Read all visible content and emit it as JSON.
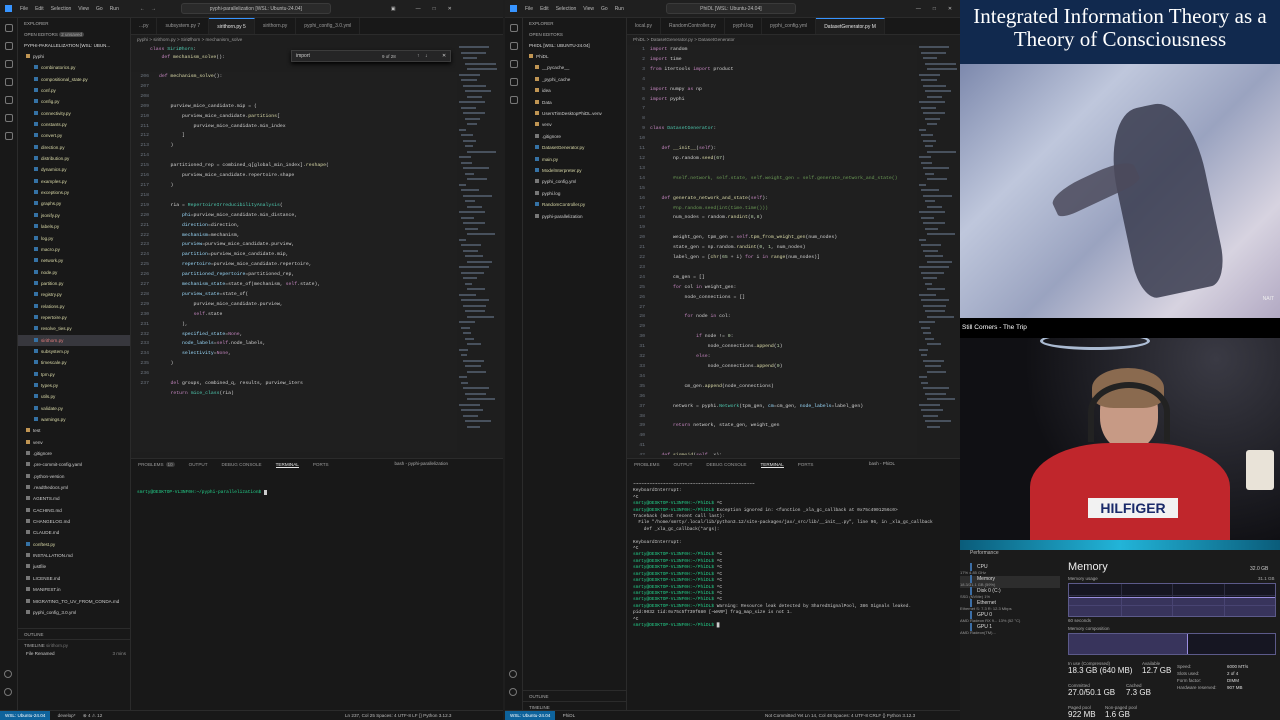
{
  "left_window": {
    "title": "pyphi-parallelization [WSL: Ubuntu-24.04]",
    "menu": [
      "File",
      "Edit",
      "Selection",
      "View",
      "Go",
      "Run"
    ],
    "explorer_label": "EXPLORER",
    "open_editors_label": "OPEN EDITORS",
    "open_editors_badge": "2 unsaved",
    "workspace_label": "PYPHI-PARALLELIZATION [WSL: UBUN...",
    "tree": [
      "pyphi",
      "combinatorics.py",
      "compositional_state.py",
      "conf.py",
      "config.py",
      "connectivity.py",
      "constants.py",
      "convert.py",
      "direction.py",
      "distribution.py",
      "dynamics.py",
      "examples.py",
      "exceptions.py",
      "graphs.py",
      "jsonify.py",
      "labels.py",
      "log.py",
      "macro.py",
      "network.py",
      "node.py",
      "partition.py",
      "registry.py",
      "relations.py",
      "repertoire.py",
      "resolve_ties.py",
      "sirithorn.py",
      "subsystem.py",
      "timescale.py",
      "tpm.py",
      "types.py",
      "utils.py",
      "validate.py",
      "warnings.py",
      "test",
      "venv",
      ".gitignore",
      ".pre-commit-config.yaml",
      ".python-version",
      ".readthedocs.yml",
      "AGENTS.md",
      "CACHING.md",
      "CHANGELOG.md",
      "CLAUDE.md",
      "conftest.py",
      "INSTALLATION.md",
      "justfile",
      "LICENSE.md",
      "MANIFEST.in",
      "MIGRATING_TO_UV_FROM_CONDA.md",
      "pyphi_config_3.0.yml"
    ],
    "outline_label": "OUTLINE",
    "timeline_label": "TIMELINE",
    "timeline_sub": "sirithorn.py",
    "timeline_item": "File Renamed",
    "timeline_time": "3 mins",
    "tabs": [
      "...py",
      "subsystem.py 7",
      "sirithorn.py 5",
      "sirithorn.py",
      "pyphi_config_3.0.yml"
    ],
    "breadcrumb": "pyphi > sirithorn.py > SiriØhorn > mechanism_solve",
    "find_text": "import",
    "find_count": "9 of 28",
    "line_numbers": [
      "206",
      "207",
      "208",
      "209",
      "210",
      "211",
      "212",
      "213",
      "214",
      "215",
      "216",
      "217",
      "218",
      "219",
      "220",
      "221",
      "222",
      "223",
      "224",
      "225",
      "226",
      "227",
      "228",
      "229",
      "230",
      "231",
      "232",
      "233",
      "234",
      "235",
      "236",
      "237"
    ],
    "panel_tabs": [
      "PROBLEMS",
      "OUTPUT",
      "DEBUG CONSOLE",
      "TERMINAL",
      "PORTS"
    ],
    "problems_count": "10",
    "terminal_name": "bash - pyphi-parallelization",
    "terminal_prompt": "smrty@DESKTOP-VL3NF0H:~/pyphi-parallelization$",
    "status_remote": "WSL: Ubuntu-24.04",
    "status_branch": "develop*",
    "status_errors": "⊗ 4  ⚠ 12",
    "status_right": "Ln 237, Col 25   Spaces: 4   UTF-8   LF   {} Python   3.12.3"
  },
  "middle_window": {
    "title": "PhiDL [WSL: Ubuntu-24.04]",
    "menu": [
      "File",
      "Edit",
      "Selection",
      "View",
      "Go",
      "Run"
    ],
    "explorer_label": "EXPLORER",
    "open_editors_label": "OPEN EDITORS",
    "workspace_label": "PHIDL [WSL: UBUNTU-24.04]",
    "tree": [
      "PhiDL",
      "__pycache__",
      "_pyphi_cache",
      "idea",
      "Data",
      "UsersTimDesktopPhiDL.venv",
      "venv",
      ".gitignore",
      "DatasetGenerator.py",
      "main.py",
      "ModelInterpreter.py",
      "pyphi_config.yml",
      "pyphi.log",
      "RandomController.py",
      "pyphi-parallelization"
    ],
    "outline_label": "OUTLINE",
    "timeline_label": "TIMELINE",
    "tabs": [
      "local.py",
      "RandomController.py",
      "pyphi.log",
      "pyphi_config.yml",
      "DatasetGenerator.py M"
    ],
    "breadcrumb": "PhiDL > DatasetGenerator.py > DatasetGenerator",
    "line_numbers": [
      "1",
      "2",
      "3",
      "4",
      "5",
      "6",
      "7",
      "8",
      "9",
      "10",
      "11",
      "12",
      "13",
      "14",
      "15",
      "16",
      "17",
      "18",
      "19",
      "20",
      "21",
      "22",
      "23",
      "24",
      "25",
      "26",
      "27",
      "28",
      "29",
      "30",
      "31",
      "32",
      "33",
      "34",
      "35",
      "36",
      "37",
      "38",
      "39",
      "40",
      "41",
      "42",
      "43"
    ],
    "panel_tabs": [
      "PROBLEMS",
      "OUTPUT",
      "DEBUG CONSOLE",
      "TERMINAL",
      "PORTS"
    ],
    "terminal_name": "bash - PhiDL",
    "terminal_lines": [
      {
        "t": "plain",
        "s": "~~~~~~~~~~~~~~~~~~~~~~~~~~~~~~~~~~~~~~~~~~~~~"
      },
      {
        "t": "plain",
        "s": "KeyboardInterrupt:"
      },
      {
        "t": "plain",
        "s": "^C"
      },
      {
        "t": "prompt",
        "s": "smrty@DESKTOP-VL3NF0H:~/PhiDL$ ^C"
      },
      {
        "t": "prompt",
        "s": "smrty@DESKTOP-VL3NF0H:~/PhiDL$ Exception ignored in: <function _xla_gc_callback at 0x75c4901256c0>"
      },
      {
        "t": "plain",
        "s": "Traceback (most recent call last):"
      },
      {
        "t": "plain",
        "s": "  File \"/home/smrty/.local/lib/python3.12/site-packages/jax/_src/lib/__init__.py\", line 96, in _xla_gc_callback"
      },
      {
        "t": "plain",
        "s": "    def _xla_gc_callback(*args):"
      },
      {
        "t": "plain",
        "s": ""
      },
      {
        "t": "plain",
        "s": "KeyboardInterrupt:"
      },
      {
        "t": "plain",
        "s": "^C"
      },
      {
        "t": "prompt",
        "s": "smrty@DESKTOP-VL3NF0H:~/PhiDL$ ^C"
      },
      {
        "t": "prompt",
        "s": "smrty@DESKTOP-VL3NF0H:~/PhiDL$ ^C"
      },
      {
        "t": "prompt",
        "s": "smrty@DESKTOP-VL3NF0H:~/PhiDL$ ^C"
      },
      {
        "t": "prompt",
        "s": "smrty@DESKTOP-VL3NF0H:~/PhiDL$ ^C"
      },
      {
        "t": "prompt",
        "s": "smrty@DESKTOP-VL3NF0H:~/PhiDL$ ^C"
      },
      {
        "t": "prompt",
        "s": "smrty@DESKTOP-VL3NF0H:~/PhiDL$ ^C"
      },
      {
        "t": "prompt",
        "s": "smrty@DESKTOP-VL3NF0H:~/PhiDL$ ^C"
      },
      {
        "t": "prompt",
        "s": "smrty@DESKTOP-VL3NF0H:~/PhiDL$ ^C"
      },
      {
        "t": "prompt",
        "s": "smrty@DESKTOP-VL3NF0H:~/PhiDL$ Warning: Resource leak detected by SharedSignalPool, 386 Signals leaked."
      },
      {
        "t": "plain",
        "s": "pid:9032 tid:0x75c5f739f680 [~WARP] frag_map_size is not 1."
      },
      {
        "t": "plain",
        "s": "^C"
      },
      {
        "t": "prompt",
        "s": "smrty@DESKTOP-VL3NF0H:~/PhiDL$ █"
      }
    ],
    "status_remote": "WSL: Ubuntu-24.04",
    "status_branch": "PhiDL",
    "status_right": "Not Committed Yet   Ln 14, Col 48   Spaces: 4   UTF-8   CRLF   {} Python   3.12.3"
  },
  "stream": {
    "title": "Integrated Information Theory as a Theory of Consciousness",
    "video_caption": "Still Corners - The Trip",
    "video_watermark": "NAIT",
    "shirt_text": "HILFIGER"
  },
  "task_manager": {
    "heading": "Performance",
    "items": [
      {
        "name": "CPU",
        "sub": "17%  4.85 GHz"
      },
      {
        "name": "Memory",
        "sub": "18.3/31.1 GB (59%)"
      },
      {
        "name": "Disk 0 (C:)",
        "sub": "SSD (NVMe)\n1%"
      },
      {
        "name": "Ethernet",
        "sub": "Ethernet\nS: 7.3  R: 12.3 Mbps"
      },
      {
        "name": "GPU 0",
        "sub": "AMD Radeon RX 9...\n13% (52 °C)"
      },
      {
        "name": "GPU 1",
        "sub": "AMD Radeon(TM)..."
      }
    ],
    "memory_title": "Memory",
    "memory_total": "32.0 GB",
    "memory_usage_label": "Memory usage",
    "memory_usage_max": "31.1 GB",
    "seconds_label": "60 seconds",
    "composition_label": "Memory composition",
    "in_use_label": "In use (Compressed)",
    "in_use_value": "18.3 GB (640 MB)",
    "available_label": "Available",
    "available_value": "12.7 GB",
    "committed_label": "Committed",
    "committed_value": "27.0/50.1 GB",
    "cached_label": "Cached",
    "cached_value": "7.3 GB",
    "paged_label": "Paged pool",
    "paged_value": "922 MB",
    "nonpaged_label": "Non-paged pool",
    "nonpaged_value": "1.6 GB",
    "speed_label": "Speed:",
    "speed_value": "6000 MT/s",
    "slots_label": "Slots used:",
    "slots_value": "2 of 4",
    "form_label": "Form factor:",
    "form_value": "DIMM",
    "reserved_label": "Hardware reserved:",
    "reserved_value": "907 MB"
  }
}
